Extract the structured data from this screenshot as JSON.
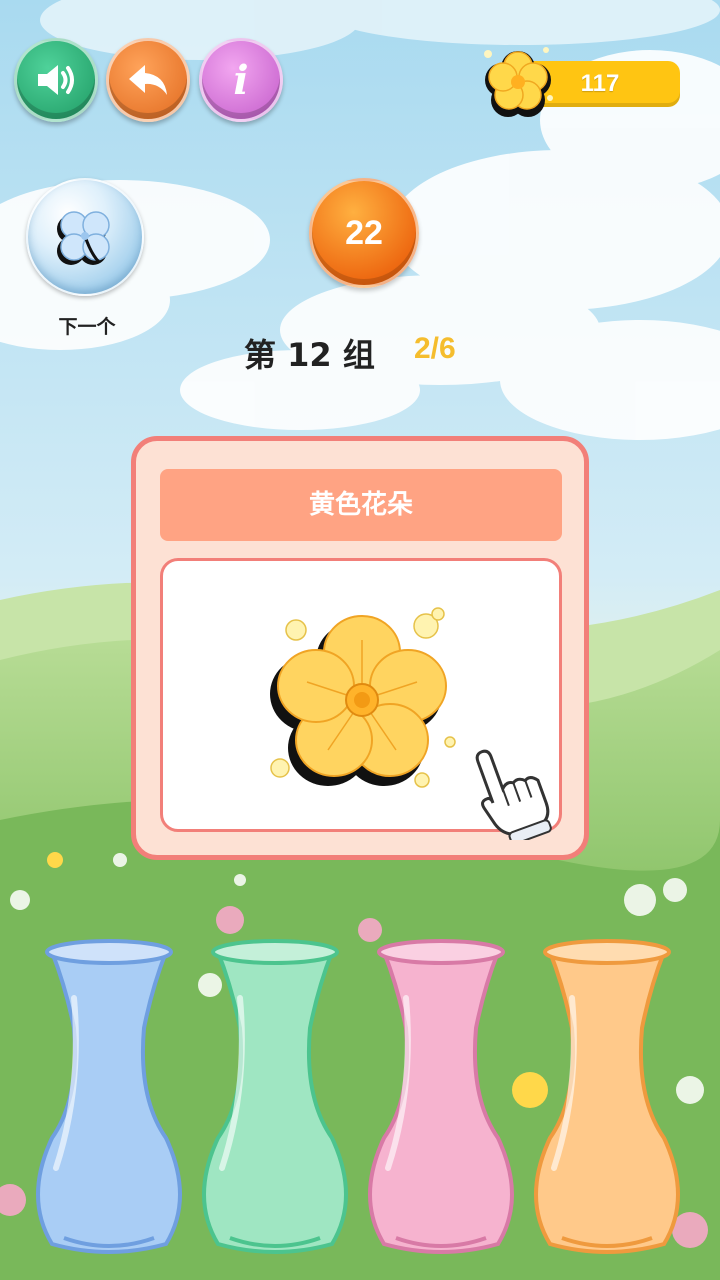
{
  "toolbar": {
    "sound_icon": "speaker-icon",
    "back_icon": "undo-arrow-icon",
    "info_label": "i"
  },
  "coins": {
    "count": "117",
    "icon": "yellow-flower-icon"
  },
  "next": {
    "label": "下一个",
    "icon": "blue-clover-icon"
  },
  "timer": {
    "value": "22"
  },
  "group": {
    "title": "第 12 组",
    "progress": "2/6"
  },
  "card": {
    "title": "黄色花朵",
    "flower_icon": "yellow-flower-icon",
    "hint_icon": "pointing-hand-icon"
  },
  "vases": [
    {
      "color": "blue",
      "fill": "#a9cdf5",
      "stroke": "#6f9fe0"
    },
    {
      "color": "green",
      "fill": "#9fe6c2",
      "stroke": "#4cc48e"
    },
    {
      "color": "pink",
      "fill": "#f6b3cf",
      "stroke": "#d87aa6"
    },
    {
      "color": "orange",
      "fill": "#ffc98a",
      "stroke": "#ef9a3e"
    }
  ],
  "colors": {
    "sky": "#bde3f1",
    "grass": "#8fc66a",
    "card_border": "#f27f79",
    "card_header": "#ffa383",
    "coin_bar": "#ffc512",
    "progress_text": "#f5bd2e"
  }
}
